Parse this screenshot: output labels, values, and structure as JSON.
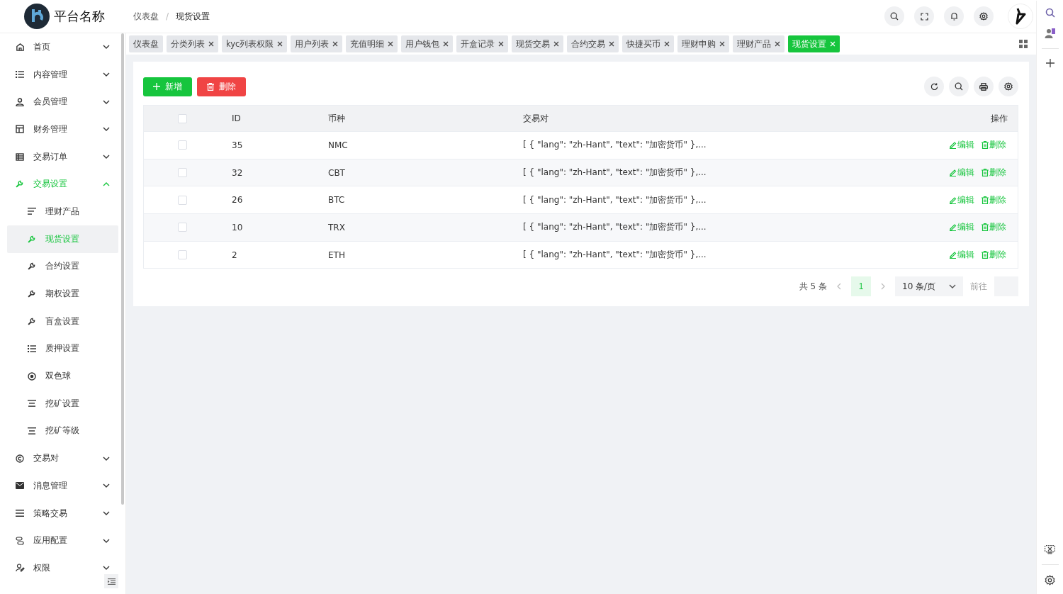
{
  "header": {
    "platform_name": "平台名称",
    "breadcrumb_separator": "/",
    "breadcrumb": [
      {
        "label": "仪表盘"
      },
      {
        "label": "现货设置"
      }
    ]
  },
  "sidebar": {
    "items": [
      {
        "label": "首页",
        "expanded": false
      },
      {
        "label": "内容管理",
        "expanded": false
      },
      {
        "label": "会员管理",
        "expanded": false
      },
      {
        "label": "财务管理",
        "expanded": false
      },
      {
        "label": "交易订单",
        "expanded": false
      },
      {
        "label": "交易设置",
        "expanded": true,
        "children": [
          {
            "label": "理财产品",
            "selected": false
          },
          {
            "label": "现货设置",
            "selected": true
          },
          {
            "label": "合约设置",
            "selected": false
          },
          {
            "label": "期权设置",
            "selected": false
          },
          {
            "label": "盲盒设置",
            "selected": false
          },
          {
            "label": "质押设置",
            "selected": false
          },
          {
            "label": "双色球",
            "selected": false
          },
          {
            "label": "挖矿设置",
            "selected": false
          },
          {
            "label": "挖矿等级",
            "selected": false
          }
        ]
      },
      {
        "label": "交易对",
        "expanded": false
      },
      {
        "label": "消息管理",
        "expanded": false
      },
      {
        "label": "策略交易",
        "expanded": false
      },
      {
        "label": "应用配置",
        "expanded": false
      },
      {
        "label": "权限",
        "expanded": false
      }
    ]
  },
  "tabs": [
    {
      "label": "仪表盘",
      "closable": false,
      "selected": false
    },
    {
      "label": "分类列表",
      "closable": true,
      "selected": false
    },
    {
      "label": "kyc列表权限",
      "closable": true,
      "selected": false
    },
    {
      "label": "用户列表",
      "closable": true,
      "selected": false
    },
    {
      "label": "充值明细",
      "closable": true,
      "selected": false
    },
    {
      "label": "用户钱包",
      "closable": true,
      "selected": false
    },
    {
      "label": "开盒记录",
      "closable": true,
      "selected": false
    },
    {
      "label": "现货交易",
      "closable": true,
      "selected": false
    },
    {
      "label": "合约交易",
      "closable": true,
      "selected": false
    },
    {
      "label": "快捷买币",
      "closable": true,
      "selected": false
    },
    {
      "label": "理财申购",
      "closable": true,
      "selected": false
    },
    {
      "label": "理财产品",
      "closable": true,
      "selected": false
    },
    {
      "label": "现货设置",
      "closable": true,
      "selected": true
    }
  ],
  "toolbar": {
    "add_button": "新增",
    "delete_button": "删除"
  },
  "table": {
    "all_checked": false,
    "columns": [
      "ID",
      "币种",
      "交易对",
      "操作"
    ],
    "rows": [
      {
        "checked": false,
        "id": "35",
        "coin": "NMC",
        "pair": "[ { \"lang\": \"zh-Hant\", \"text\": \"加密货币\" },...",
        "edit": "编辑",
        "delete": "删除"
      },
      {
        "checked": false,
        "id": "32",
        "coin": "CBT",
        "pair": "[ { \"lang\": \"zh-Hant\", \"text\": \"加密货币\" },...",
        "edit": "编辑",
        "delete": "删除"
      },
      {
        "checked": false,
        "id": "26",
        "coin": "BTC",
        "pair": "[ { \"lang\": \"zh-Hant\", \"text\": \"加密货币\" },...",
        "edit": "编辑",
        "delete": "删除"
      },
      {
        "checked": false,
        "id": "10",
        "coin": "TRX",
        "pair": "[ { \"lang\": \"zh-Hant\", \"text\": \"加密货币\" },...",
        "edit": "编辑",
        "delete": "删除"
      },
      {
        "checked": false,
        "id": "2",
        "coin": "ETH",
        "pair": "[ { \"lang\": \"zh-Hant\", \"text\": \"加密货币\" },...",
        "edit": "编辑",
        "delete": "删除"
      }
    ]
  },
  "pagination": {
    "total": "共 5 条",
    "pages": [
      {
        "label": "1",
        "selected": true
      }
    ],
    "page_size": "10 条/页",
    "goto_label": "前往"
  }
}
